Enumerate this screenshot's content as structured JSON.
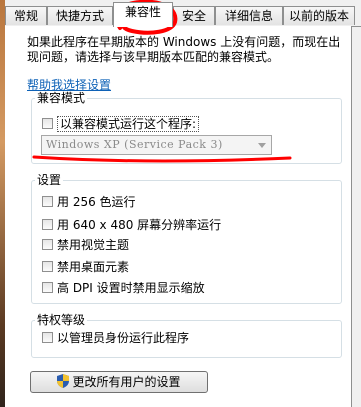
{
  "tabs": [
    "常规",
    "快捷方式",
    "兼容性",
    "安全",
    "详细信息",
    "以前的版本"
  ],
  "intro": {
    "line1": "如果此程序在早期版本的 Windows 上没有问题，而现在出",
    "line2": "现问题，请选择与该早期版本匹配的兼容模式。"
  },
  "help_link": "帮助我选择设置",
  "compat": {
    "title": "兼容模式",
    "checkbox": "以兼容模式运行这个程序:",
    "select_value": "Windows XP (Service Pack 3)"
  },
  "settings": {
    "title": "设置",
    "items": [
      "用 256 色运行",
      "用 640 x 480 屏幕分辨率运行",
      "禁用视觉主题",
      "禁用桌面元素",
      "高 DPI 设置时禁用显示缩放"
    ]
  },
  "privilege": {
    "title": "特权等级",
    "checkbox": "以管理员身份运行此程序"
  },
  "button": "更改所有用户的设置",
  "colors": {
    "link": "#0e62b7",
    "annotation": "#ff0000"
  }
}
